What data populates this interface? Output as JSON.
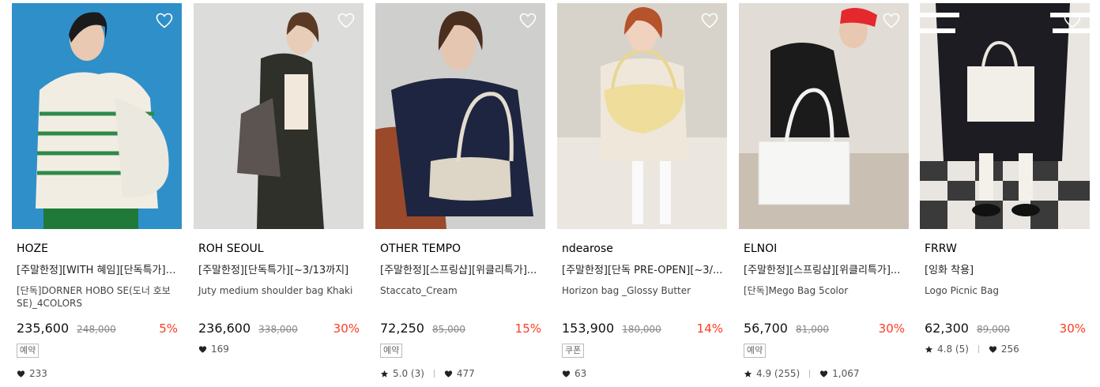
{
  "products": [
    {
      "brand": "HOZE",
      "name_line1": "[주말한정][WITH 혜임][단독특가][...",
      "name_line2": "[단독]DORNER HOBO SE(도너 호보 SE)_4COLORS",
      "price": "235,600",
      "original_price": "248,000",
      "discount": "5%",
      "badge": "예약",
      "likes": "233"
    },
    {
      "brand": "ROH SEOUL",
      "name_line1": "[주말한정][단독특가][~3/13까지]",
      "name_line2": "Juty medium shoulder bag Khaki",
      "price": "236,600",
      "original_price": "338,000",
      "discount": "30%",
      "likes": "169"
    },
    {
      "brand": "OTHER TEMPO",
      "name_line1": "[주말한정][스프링샵][위클리특가]...",
      "name_line2": "Staccato_Cream",
      "price": "72,250",
      "original_price": "85,000",
      "discount": "15%",
      "badge": "예약",
      "rating": "5.0 (3)",
      "likes": "477"
    },
    {
      "brand": "ndearose",
      "name_line1": "[주말한정][단독 PRE-OPEN][~3/...",
      "name_line2": "Horizon bag _Glossy Butter",
      "price": "153,900",
      "original_price": "180,000",
      "discount": "14%",
      "badge": "쿠폰",
      "likes": "63"
    },
    {
      "brand": "ELNOI",
      "name_line1": "[주말한정][스프링샵][위클리특가]...",
      "name_line2": "[단독]Mego Bag 5color",
      "price": "56,700",
      "original_price": "81,000",
      "discount": "30%",
      "badge": "예약",
      "rating": "4.9 (255)",
      "likes": "1,067"
    },
    {
      "brand": "FRRW",
      "name_line1": "[잉화 착용]",
      "name_line2": "Logo Picnic Bag",
      "price": "62,300",
      "original_price": "89,000",
      "discount": "30%",
      "rating": "4.8 (5)",
      "likes": "256"
    }
  ],
  "colors": {
    "discount": "#ff3b1f",
    "text": "#111111",
    "muted": "#888888"
  },
  "icons": {
    "wishlist": "heart-outline-icon",
    "likes": "heart-icon",
    "rating": "star-icon"
  }
}
